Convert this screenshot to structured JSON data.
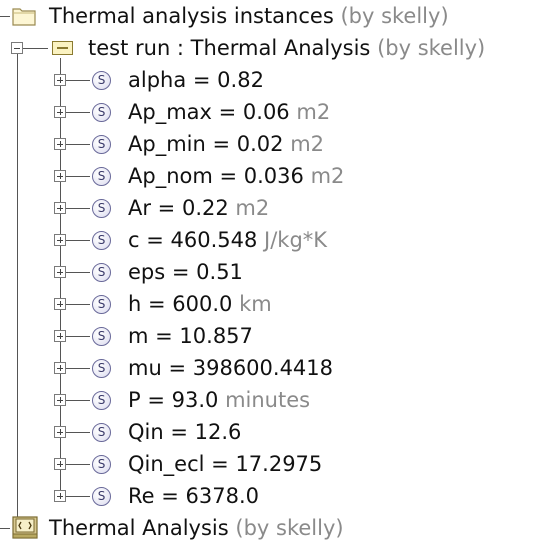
{
  "root": {
    "label": "Thermal analysis instances",
    "suffix": "(by skelly)",
    "icon": "folder-icon"
  },
  "instance": {
    "label": "test run : Thermal Analysis",
    "suffix": "(by skelly)",
    "icon": "instance-icon"
  },
  "slots": [
    {
      "name": "alpha",
      "eq": " = ",
      "value": "0.82",
      "unit": ""
    },
    {
      "name": "Ap_max",
      "eq": " = ",
      "value": "0.06",
      "unit": "m2"
    },
    {
      "name": "Ap_min",
      "eq": " = ",
      "value": "0.02",
      "unit": "m2"
    },
    {
      "name": "Ap_nom",
      "eq": " = ",
      "value": "0.036",
      "unit": "m2"
    },
    {
      "name": "Ar",
      "eq": " = ",
      "value": "0.22",
      "unit": "m2"
    },
    {
      "name": "c",
      "eq": " = ",
      "value": "460.548",
      "unit": "J/kg*K"
    },
    {
      "name": "eps",
      "eq": " = ",
      "value": "0.51",
      "unit": ""
    },
    {
      "name": "h",
      "eq": " = ",
      "value": "600.0",
      "unit": "km"
    },
    {
      "name": "m",
      "eq": " = ",
      "value": "10.857",
      "unit": ""
    },
    {
      "name": "mu",
      "eq": " = ",
      "value": "398600.4418",
      "unit": ""
    },
    {
      "name": "P",
      "eq": " = ",
      "value": "93.0",
      "unit": "minutes"
    },
    {
      "name": "Qin",
      "eq": " = ",
      "value": "12.6",
      "unit": ""
    },
    {
      "name": "Qin_ecl",
      "eq": " = ",
      "value": "17.2975",
      "unit": ""
    },
    {
      "name": "Re",
      "eq": " = ",
      "value": "6378.0",
      "unit": ""
    }
  ],
  "slot_icon_letter": "S",
  "class_node": {
    "label": "Thermal Analysis",
    "suffix": "(by skelly)",
    "icon": "class-icon"
  }
}
